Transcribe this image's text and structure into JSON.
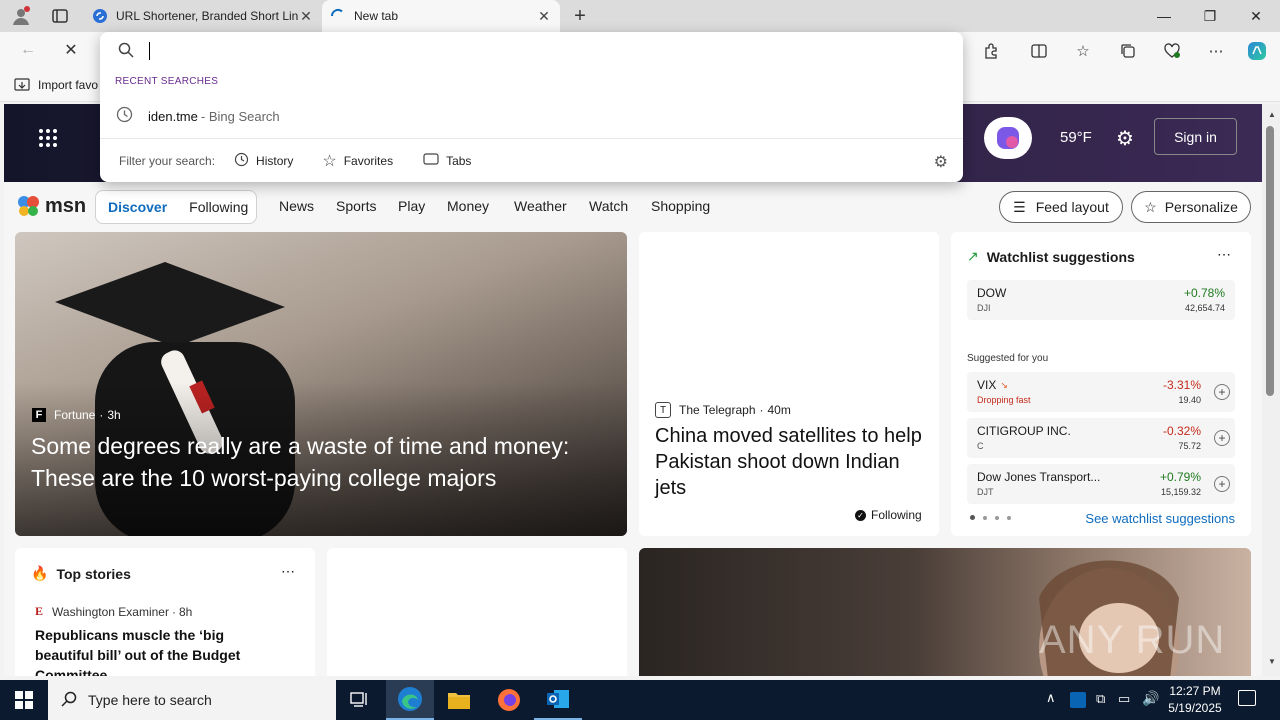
{
  "browser": {
    "tabs": [
      {
        "title": "URL Shortener, Branded Short Lin",
        "active": false
      },
      {
        "title": "New tab",
        "active": true
      }
    ],
    "favorites_bar": {
      "import_label": "Import favo"
    }
  },
  "omnibox": {
    "recent_header": "RECENT SEARCHES",
    "recent": [
      {
        "query": "iden.tme",
        "source": "- Bing Search"
      }
    ],
    "filter_label": "Filter your search:",
    "filters": [
      "History",
      "Favorites",
      "Tabs"
    ]
  },
  "msn": {
    "logo_text": "msn",
    "temperature": "59°F",
    "signin": "Sign in",
    "tabs": [
      "Discover",
      "Following"
    ],
    "nav": [
      "News",
      "Sports",
      "Play",
      "Money",
      "Weather",
      "Watch",
      "Shopping"
    ],
    "feed_layout": "Feed layout",
    "personalize": "Personalize",
    "main_story": {
      "source": "Fortune",
      "time": "3h",
      "title": "Some degrees really are a waste of time and money: These are the 10 worst-paying college majors"
    },
    "side_story": {
      "source": "The Telegraph",
      "time": "40m",
      "title": "China moved satellites to help Pakistan shoot down Indian jets",
      "following": "Following"
    },
    "watchlist": {
      "title": "Watchlist suggestions",
      "rows": [
        {
          "name": "DOW",
          "ticker": "DJI",
          "change": "+0.78%",
          "price": "42,654.74",
          "positive": true,
          "note": ""
        }
      ],
      "suggested_label": "Suggested for you",
      "suggested": [
        {
          "name": "VIX",
          "ticker": "",
          "change": "-3.31%",
          "price": "19.40",
          "positive": false,
          "note": "Dropping fast"
        },
        {
          "name": "CITIGROUP INC.",
          "ticker": "C",
          "change": "-0.32%",
          "price": "75.72",
          "positive": false,
          "note": ""
        },
        {
          "name": "Dow Jones Transport...",
          "ticker": "DJT",
          "change": "+0.79%",
          "price": "15,159.32",
          "positive": true,
          "note": ""
        }
      ],
      "see_all": "See watchlist suggestions"
    },
    "top_stories": {
      "title": "Top stories",
      "source": "Washington Examiner",
      "time": "8h",
      "headline": "Republicans muscle the ‘big beautiful bill’ out of the Budget Committee"
    },
    "watermark": "ANY RUN"
  },
  "taskbar": {
    "search_placeholder": "Type here to search",
    "time": "12:27 PM",
    "date": "5/19/2025"
  },
  "colors": {
    "accent": "#0f6cbd",
    "positive": "#1f7a1f",
    "negative": "#c42b1c"
  }
}
